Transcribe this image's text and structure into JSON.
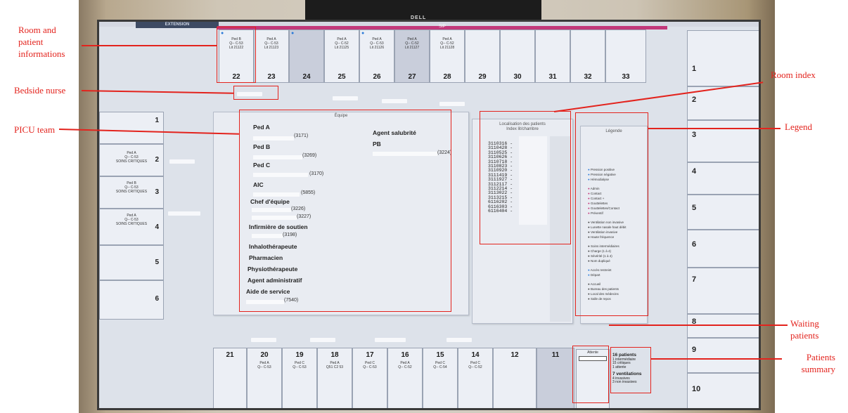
{
  "monitor_brand": "DELL",
  "header": {
    "extension_label": "EXTENSION",
    "sip_label": "SIP"
  },
  "top_rooms": [
    {
      "num": "22",
      "ped": "Ped B",
      "code": "Q-- C-53",
      "lit": "Lit 21122"
    },
    {
      "num": "23",
      "ped": "Ped A",
      "code": "Q-- C-53",
      "lit": "Lit 21123"
    },
    {
      "num": "24",
      "ped": "",
      "code": "",
      "lit": ""
    },
    {
      "num": "25",
      "ped": "Ped A",
      "code": "Q-- C-52",
      "lit": "Lit 21125"
    },
    {
      "num": "26",
      "ped": "Ped A",
      "code": "Q-- C-53",
      "lit": "Lit 21126"
    },
    {
      "num": "27",
      "ped": "Ped A",
      "code": "Q-- C-52",
      "lit": "Lit 21127"
    },
    {
      "num": "28",
      "ped": "Ped A",
      "code": "Q-- C-52",
      "lit": "Lit 21128"
    },
    {
      "num": "29",
      "ped": "",
      "code": "",
      "lit": ""
    },
    {
      "num": "30",
      "ped": "",
      "code": "",
      "lit": ""
    },
    {
      "num": "31",
      "ped": "",
      "code": "",
      "lit": ""
    },
    {
      "num": "32",
      "ped": "",
      "code": "",
      "lit": ""
    },
    {
      "num": "33",
      "ped": "",
      "code": "",
      "lit": ""
    }
  ],
  "right_rooms": [
    "1",
    "2",
    "3",
    "4",
    "5",
    "6",
    "7",
    "8",
    "9",
    "10"
  ],
  "left_rooms": [
    {
      "num": "1",
      "ped": "",
      "code": "",
      "note": ""
    },
    {
      "num": "2",
      "ped": "Ped A",
      "code": "Q-- C-53",
      "note": "SOINS CRITIQUES"
    },
    {
      "num": "3",
      "ped": "Ped B",
      "code": "Q-- C-53",
      "note": "SOINS CRITIQUES"
    },
    {
      "num": "4",
      "ped": "Ped A",
      "code": "Q-- C-53",
      "note": "SOINS CRITIQUES"
    },
    {
      "num": "5",
      "ped": "",
      "code": "",
      "note": ""
    },
    {
      "num": "6",
      "ped": "",
      "code": "",
      "note": ""
    }
  ],
  "bottom_rooms": [
    {
      "num": "21",
      "ped": "",
      "code": ""
    },
    {
      "num": "20",
      "ped": "Ped A",
      "code": "Q-- C-53"
    },
    {
      "num": "19",
      "ped": "Ped C",
      "code": "Q-- C-53"
    },
    {
      "num": "18",
      "ped": "Ped A",
      "code": "Q51 C2 53"
    },
    {
      "num": "17",
      "ped": "Ped C",
      "code": "Q-- C-53"
    },
    {
      "num": "16",
      "ped": "Ped A",
      "code": "Q-- C-52"
    },
    {
      "num": "15",
      "ped": "Ped C",
      "code": "Q-- C-54"
    },
    {
      "num": "14",
      "ped": "Ped C",
      "code": "Q-- C-52"
    },
    {
      "num": "12",
      "ped": "",
      "code": ""
    },
    {
      "num": "11",
      "ped": "",
      "code": ""
    }
  ],
  "team": {
    "title": "Équipe",
    "left": [
      {
        "role": "Ped A",
        "ext": "(3171)"
      },
      {
        "role": "Ped B",
        "ext": "(3269)"
      },
      {
        "role": "Ped C",
        "ext": "(3170)"
      },
      {
        "role": "AIC",
        "ext": "(5855)"
      },
      {
        "role": "Chef d'équipe",
        "ext": "(3226)",
        "ext2": "(3227)"
      },
      {
        "role": "Infirmière de soutien",
        "ext": "(3198)"
      },
      {
        "role": "Inhalothérapeute",
        "ext": ""
      },
      {
        "role": "Pharmacien",
        "ext": ""
      },
      {
        "role": "Physiothérapeute",
        "ext": ""
      },
      {
        "role": "Agent administratif",
        "ext": ""
      },
      {
        "role": "Aide de service",
        "ext": "(7540)"
      }
    ],
    "right": [
      {
        "role": "Agent salubrité",
        "ext": ""
      },
      {
        "role": "PB",
        "ext": "(3224)"
      }
    ]
  },
  "localisation": {
    "title": "Localisation des patients",
    "subtitle": "Index lit/chambre",
    "entries": [
      "3110316 -",
      "3110428 -",
      "3110525 -",
      "3110626 -",
      "3110718 -",
      "3110823 -",
      "3110920 -",
      "3111419 -",
      "3111927 -",
      "3112117 -",
      "3112214 -",
      "3113022 -",
      "3113215 -",
      "6116202 -",
      "6116303 -",
      "6116404 -"
    ]
  },
  "legend": {
    "title": "Légende",
    "groups": [
      [
        "Pression positive",
        "Pression négative",
        "Hémodialyse"
      ],
      [
        "Admin",
        "Contact",
        "Contact +",
        "Gouttelettes",
        "Gouttelettes/Contact",
        "Préventif"
      ],
      [
        "Ventilation non invasive",
        "Lunette nasale haut débit",
        "Ventilation invasive",
        "Haute fréquence"
      ],
      [
        "Soins intermédiaires",
        "Charge (1 à 4)",
        "Sévérité (1 à 4)",
        "Nom dupliqué"
      ],
      [
        "Accès restreint",
        "Départ"
      ],
      [
        "Accueil",
        "Bureau des patients",
        "Local des médecins",
        "Salle de repos"
      ]
    ]
  },
  "waiting": {
    "label": "Attente"
  },
  "summary": {
    "patients_title": "16 patients",
    "patients_lines": [
      "1 intermédiaire",
      "15 critiques",
      "1 attente"
    ],
    "ventilation_title": "7 ventilations",
    "ventilation_lines": [
      "4 invasives",
      "3 non invasives"
    ]
  },
  "annotations": {
    "room_info": "Room and patient informations",
    "bedside_nurse": "Bedside nurse",
    "picu_team": "PICU team",
    "room_index": "Room index",
    "legend": "Legend",
    "waiting_patients": "Waiting patients",
    "patients_summary": "Patients summary"
  },
  "colors": {
    "annotation": "#e3231d",
    "sip_bar": "#c2387a",
    "icon_blue": "#2a7ad8"
  }
}
